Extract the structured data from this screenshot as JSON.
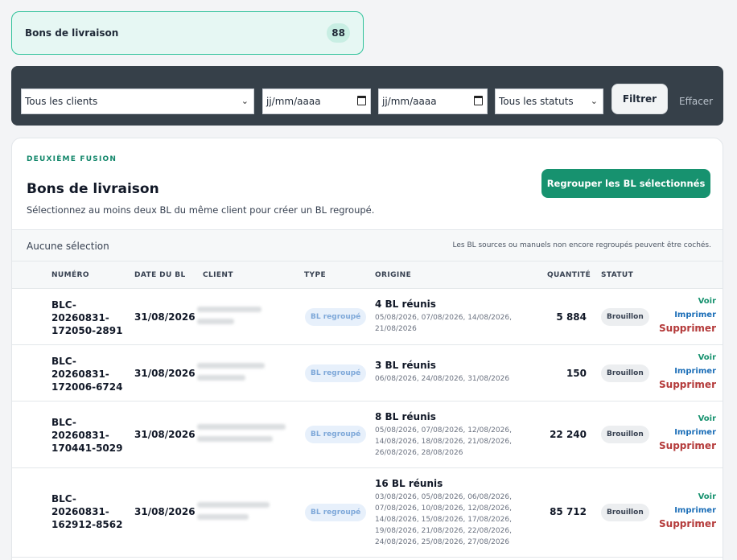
{
  "tab": {
    "title": "Bons de livraison",
    "count": "88"
  },
  "filters": {
    "client": "Tous les clients",
    "date_from": "jj/mm/aaaa",
    "date_to": "jj/mm/aaaa",
    "status": "Tous les statuts",
    "filter_label": "Filtrer",
    "clear_label": "Effacer"
  },
  "panel": {
    "eyebrow": "DEUXIÈME FUSION",
    "title": "Bons de livraison",
    "subtitle": "Sélectionnez au moins deux BL du même client pour créer un BL regroupé.",
    "group_button": "Regrouper les BL sélectionnés",
    "selection_status": "Aucune sélection",
    "selection_note": "Les BL sources ou manuels non encore regroupés peuvent être cochés."
  },
  "columns": [
    "NUMÉRO",
    "DATE DU BL",
    "CLIENT",
    "TYPE",
    "ORIGINE",
    "QUANTITÉ",
    "STATUT"
  ],
  "actions": {
    "view": "Voir",
    "print": "Imprimer",
    "delete": "Supprimer"
  },
  "rows": [
    {
      "num": [
        "BLC-",
        "20260831-",
        "172050-2891"
      ],
      "date": "31/08/2026",
      "type": "BL regroupé",
      "origin_title": "4 BL réunis",
      "origin_dates": [
        "05/08/2026, 07/08/2026, 14/08/2026,",
        "21/08/2026"
      ],
      "qty": "5 884",
      "status": "Brouillon"
    },
    {
      "num": [
        "BLC-",
        "20260831-",
        "172006-6724"
      ],
      "date": "31/08/2026",
      "type": "BL regroupé",
      "origin_title": "3 BL réunis",
      "origin_dates": [
        "06/08/2026, 24/08/2026, 31/08/2026"
      ],
      "qty": "150",
      "status": "Brouillon"
    },
    {
      "num": [
        "BLC-",
        "20260831-",
        "170441-5029"
      ],
      "date": "31/08/2026",
      "type": "BL regroupé",
      "origin_title": "8 BL réunis",
      "origin_dates": [
        "05/08/2026, 07/08/2026, 12/08/2026,",
        "14/08/2026, 18/08/2026, 21/08/2026,",
        "26/08/2026, 28/08/2026"
      ],
      "qty": "22 240",
      "status": "Brouillon"
    },
    {
      "num": [
        "BLC-",
        "20260831-",
        "162912-8562"
      ],
      "date": "31/08/2026",
      "type": "BL regroupé",
      "origin_title": "16 BL réunis",
      "origin_dates": [
        "03/08/2026, 05/08/2026, 06/08/2026,",
        "07/08/2026, 10/08/2026, 12/08/2026,",
        "14/08/2026, 15/08/2026, 17/08/2026,",
        "19/08/2026, 21/08/2026, 22/08/2026,",
        "24/08/2026, 25/08/2026, 27/08/2026"
      ],
      "qty": "85 712",
      "status": "Brouillon"
    }
  ]
}
